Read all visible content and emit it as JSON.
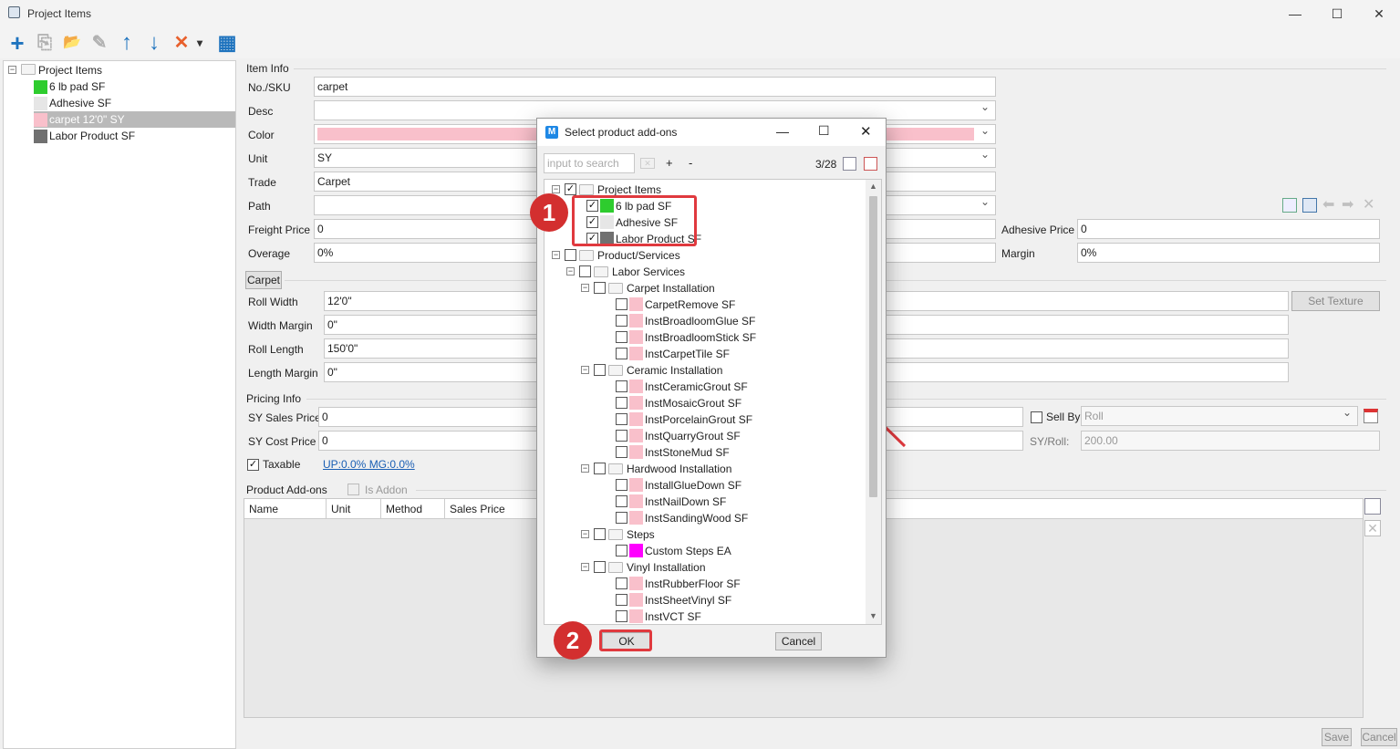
{
  "window": {
    "title": "Project Items",
    "minimize": "—",
    "maximize": "☐",
    "close": "✕"
  },
  "toolbar": {
    "add": "+",
    "copy": "⎘",
    "open": "📂",
    "edit": "✎",
    "up": "↑",
    "down": "↓",
    "delete": "✕",
    "dropdown": "▾",
    "grid": "▦",
    "colors": {
      "add": "#1e73be",
      "up": "#1e73be",
      "down": "#1e73be",
      "delete": "#e8602c",
      "disabled": "#b0b0b0"
    }
  },
  "tree": {
    "root": "Project Items",
    "items": [
      {
        "label": "6 lb pad  SF",
        "color": "#2ecc2e",
        "selected": false
      },
      {
        "label": "Adhesive  SF",
        "color": "#e6e6e6",
        "selected": false
      },
      {
        "label": "carpet 12'0\" SY",
        "color": "#f9c0cb",
        "selected": true
      },
      {
        "label": "Labor Product  SF",
        "color": "#707070",
        "selected": false
      }
    ]
  },
  "item_info": {
    "heading": "Item Info",
    "sku_label": "No./SKU",
    "sku_value": "carpet",
    "desc_label": "Desc",
    "desc_value": "",
    "color_label": "Color",
    "color_value": "#f9c0cb",
    "unit_label": "Unit",
    "unit_value": "SY",
    "trade_label": "Trade",
    "trade_value": "Carpet",
    "path_label": "Path",
    "path_value": "",
    "freight_label": "Freight Price",
    "freight_value": "0",
    "overage_label": "Overage",
    "overage_value": "0%",
    "adhesive_label": "Adhesive Price",
    "adhesive_value": "0",
    "margin_label": "Margin",
    "margin_value": "0%"
  },
  "carpet": {
    "tab": "Carpet",
    "roll_width_label": "Roll Width",
    "roll_width_value": "12'0\"",
    "width_margin_label": "Width Margin",
    "width_margin_value": "0\"",
    "roll_length_label": "Roll Length",
    "roll_length_value": "150'0\"",
    "length_margin_label": "Length Margin",
    "length_margin_value": "0\"",
    "set_texture": "Set Texture"
  },
  "pricing": {
    "heading": "Pricing Info",
    "sales_label": "SY Sales Price",
    "sales_value": "0",
    "cost_label": "SY Cost Price",
    "cost_value": "0",
    "taxable_label": "Taxable",
    "taxable_checked": true,
    "up_mg": "UP:0.0% MG:0.0%",
    "sell_by_label": "Sell By",
    "sell_by_value": "Roll",
    "sy_roll_label": "SY/Roll:",
    "sy_roll_value": "200.00"
  },
  "addons": {
    "heading": "Product Add-ons",
    "is_addon_label": "Is Addon",
    "columns": [
      "Name",
      "Unit",
      "Method",
      "Sales Price"
    ]
  },
  "footer": {
    "save": "Save",
    "cancel": "Cancel"
  },
  "dialog": {
    "title": "Select product add-ons",
    "search_placeholder": "input to search",
    "plus": "+",
    "minus": "-",
    "count": "3/28",
    "ok": "OK",
    "cancel": "Cancel",
    "nodes": [
      {
        "label": "Project Items",
        "level": 0,
        "type": "folder",
        "checked": true
      },
      {
        "label": "6 lb pad  SF",
        "level": 1,
        "type": "item",
        "checked": true,
        "color": "#2ecc2e"
      },
      {
        "label": "Adhesive  SF",
        "level": 1,
        "type": "item",
        "checked": true,
        "color": "#e6e6e6"
      },
      {
        "label": "Labor Product  SF",
        "level": 1,
        "type": "item",
        "checked": true,
        "color": "#707070"
      },
      {
        "label": "Product/Services",
        "level": 0,
        "type": "folder",
        "checked": false
      },
      {
        "label": "Labor Services",
        "level": 1,
        "type": "folder",
        "checked": false
      },
      {
        "label": "Carpet Installation",
        "level": 2,
        "type": "folder",
        "checked": false
      },
      {
        "label": "CarpetRemove  SF",
        "level": 3,
        "type": "item",
        "checked": false,
        "color": "#f9c0cb"
      },
      {
        "label": "InstBroadloomGlue  SF",
        "level": 3,
        "type": "item",
        "checked": false,
        "color": "#f9c0cb"
      },
      {
        "label": "InstBroadloomStick  SF",
        "level": 3,
        "type": "item",
        "checked": false,
        "color": "#f9c0cb"
      },
      {
        "label": "InstCarpetTile  SF",
        "level": 3,
        "type": "item",
        "checked": false,
        "color": "#f9c0cb"
      },
      {
        "label": "Ceramic Installation",
        "level": 2,
        "type": "folder",
        "checked": false
      },
      {
        "label": "InstCeramicGrout  SF",
        "level": 3,
        "type": "item",
        "checked": false,
        "color": "#f9c0cb"
      },
      {
        "label": "InstMosaicGrout  SF",
        "level": 3,
        "type": "item",
        "checked": false,
        "color": "#f9c0cb"
      },
      {
        "label": "InstPorcelainGrout  SF",
        "level": 3,
        "type": "item",
        "checked": false,
        "color": "#f9c0cb"
      },
      {
        "label": "InstQuarryGrout  SF",
        "level": 3,
        "type": "item",
        "checked": false,
        "color": "#f9c0cb"
      },
      {
        "label": "InstStoneMud  SF",
        "level": 3,
        "type": "item",
        "checked": false,
        "color": "#f9c0cb"
      },
      {
        "label": "Hardwood Installation",
        "level": 2,
        "type": "folder",
        "checked": false
      },
      {
        "label": "InstallGlueDown  SF",
        "level": 3,
        "type": "item",
        "checked": false,
        "color": "#f9c0cb"
      },
      {
        "label": "InstNailDown  SF",
        "level": 3,
        "type": "item",
        "checked": false,
        "color": "#f9c0cb"
      },
      {
        "label": "InstSandingWood  SF",
        "level": 3,
        "type": "item",
        "checked": false,
        "color": "#f9c0cb"
      },
      {
        "label": "Steps",
        "level": 2,
        "type": "folder",
        "checked": false
      },
      {
        "label": "Custom Steps  EA",
        "level": 3,
        "type": "item",
        "checked": false,
        "color": "#ff00ff"
      },
      {
        "label": "Vinyl Installation",
        "level": 2,
        "type": "folder",
        "checked": false
      },
      {
        "label": "InstRubberFloor  SF",
        "level": 3,
        "type": "item",
        "checked": false,
        "color": "#f9c0cb"
      },
      {
        "label": "InstSheetVinyl  SF",
        "level": 3,
        "type": "item",
        "checked": false,
        "color": "#f9c0cb"
      },
      {
        "label": "InstVCT  SF",
        "level": 3,
        "type": "item",
        "checked": false,
        "color": "#f9c0cb"
      }
    ]
  },
  "callouts": {
    "one": "1",
    "two": "2",
    "color": "#d32f2f"
  }
}
